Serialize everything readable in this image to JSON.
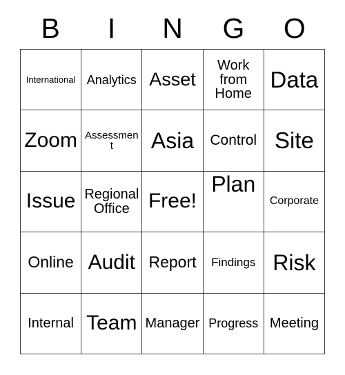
{
  "card": {
    "title": "BINGO",
    "header_letters": [
      "B",
      "I",
      "N",
      "G",
      "O"
    ],
    "grid_size": "5x5",
    "border_color": "#3f3f3f",
    "text_color": "#000000",
    "background_color": "#ffffff",
    "free_space": "Free!",
    "rows": [
      [
        {
          "label": "International",
          "size": "fs-13",
          "align": "middle"
        },
        {
          "label": "Analytics",
          "size": "fs-18",
          "align": "middle"
        },
        {
          "label": "Asset",
          "size": "fs-27",
          "align": "middle"
        },
        {
          "label": "Work from Home",
          "size": "fs-20",
          "align": "middle"
        },
        {
          "label": "Data",
          "size": "fs-33",
          "align": "middle"
        }
      ],
      [
        {
          "label": "Zoom",
          "size": "fs-30",
          "align": "middle"
        },
        {
          "label": "Assessment",
          "size": "fs-15",
          "align": "middle"
        },
        {
          "label": "Asia",
          "size": "fs-32",
          "align": "middle"
        },
        {
          "label": "Control",
          "size": "fs-21",
          "align": "middle"
        },
        {
          "label": "Site",
          "size": "fs-33",
          "align": "middle"
        }
      ],
      [
        {
          "label": "Issue",
          "size": "fs-30",
          "align": "middle"
        },
        {
          "label": "Regional Office",
          "size": "fs-20",
          "align": "middle"
        },
        {
          "label": "Free!",
          "size": "fs-30",
          "align": "middle"
        },
        {
          "label": "Plan",
          "size": "fs-32",
          "align": "top"
        },
        {
          "label": "Corporate",
          "size": "fs-16",
          "align": "middle"
        }
      ],
      [
        {
          "label": "Online",
          "size": "fs-23",
          "align": "middle"
        },
        {
          "label": "Audit",
          "size": "fs-30",
          "align": "middle"
        },
        {
          "label": "Report",
          "size": "fs-23",
          "align": "middle"
        },
        {
          "label": "Findings",
          "size": "fs-17",
          "align": "middle"
        },
        {
          "label": "Risk",
          "size": "fs-32",
          "align": "middle"
        }
      ],
      [
        {
          "label": "Internal",
          "size": "fs-20",
          "align": "middle"
        },
        {
          "label": "Team",
          "size": "fs-30",
          "align": "middle"
        },
        {
          "label": "Manager",
          "size": "fs-20",
          "align": "middle"
        },
        {
          "label": "Progress",
          "size": "fs-18",
          "align": "middle"
        },
        {
          "label": "Meeting",
          "size": "fs-20",
          "align": "middle"
        }
      ]
    ]
  }
}
